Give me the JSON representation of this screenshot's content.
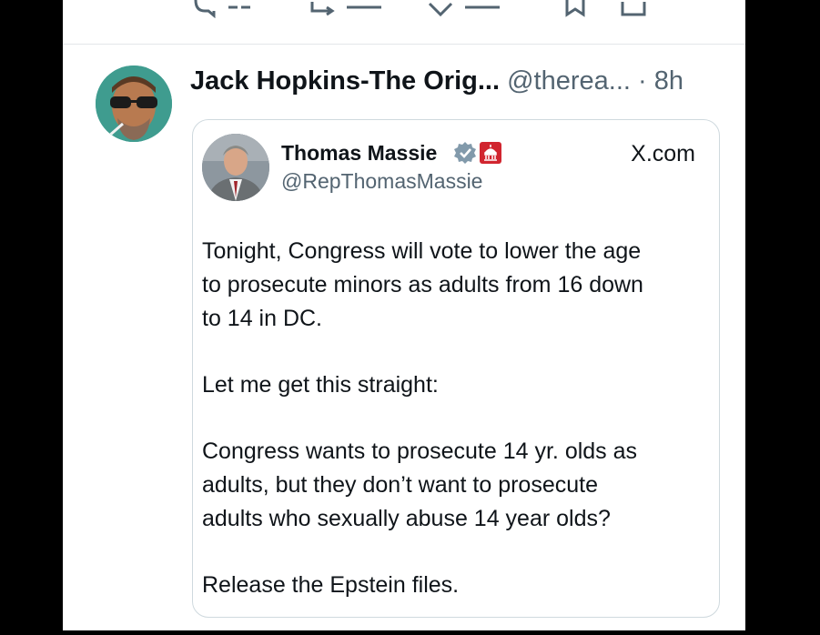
{
  "colors": {
    "background": "#000000",
    "surface": "#ffffff",
    "text_primary": "#0f1419",
    "text_secondary": "#536471",
    "border": "#cfd9de",
    "verified_badge": "#829aab",
    "affiliation_badge": "#d1252f"
  },
  "top_actions": {
    "icons": [
      "reply-icon",
      "repost-icon",
      "like-icon",
      "bookmark-icon",
      "share-icon"
    ]
  },
  "post": {
    "author_name": "Jack Hopkins-The Orig...",
    "author_handle": "@therea...",
    "separator": "·",
    "timestamp": "8h",
    "avatar": "avatar"
  },
  "quoted_card": {
    "author_name": "Thomas Massie",
    "author_handle": "@RepThomasMassie",
    "source": "X.com",
    "badges": [
      "verified-badge-icon",
      "government-affiliation-badge-icon"
    ],
    "paragraphs": [
      {
        "lines": [
          "Tonight, Congress will vote to lower the age",
          "to prosecute minors as adults from 16 down",
          "to 14 in DC."
        ]
      },
      {
        "lines": [
          "Let me get this straight:"
        ]
      },
      {
        "lines": [
          "Congress wants to prosecute 14 yr. olds as",
          "adults, but they don’t want to prosecute",
          "adults who sexually abuse 14 year olds?"
        ]
      },
      {
        "lines": [
          "Release the Epstein files."
        ]
      }
    ]
  }
}
